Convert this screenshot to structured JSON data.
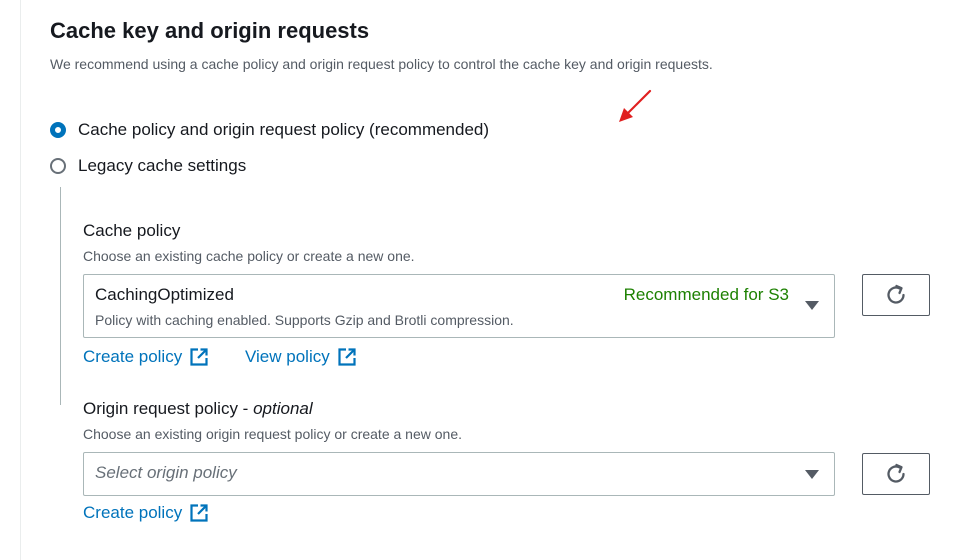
{
  "section": {
    "title": "Cache key and origin requests",
    "description": "We recommend using a cache policy and origin request policy to control the cache key and origin requests."
  },
  "options": {
    "recommended_label": "Cache policy and origin request policy (recommended)",
    "recommended_selected": true,
    "legacy_label": "Legacy cache settings",
    "legacy_selected": false
  },
  "cache_policy": {
    "label": "Cache policy",
    "description": "Choose an existing cache policy or create a new one.",
    "selected_value": "CachingOptimized",
    "selected_description": "Policy with caching enabled. Supports Gzip and Brotli compression.",
    "tag": "Recommended for S3",
    "create_link": "Create policy",
    "view_link": "View policy"
  },
  "origin_request_policy": {
    "label": "Origin request policy - ",
    "label_optional": "optional",
    "description": "Choose an existing origin request policy or create a new one.",
    "placeholder": "Select origin policy",
    "create_link": "Create policy"
  },
  "colors": {
    "accent": "#0073bb",
    "success": "#1d8102",
    "annotation_arrow": "#e02020"
  },
  "icons": [
    "red-arrow-annotation-icon",
    "caret-down-icon",
    "refresh-icon",
    "external-link-icon"
  ]
}
